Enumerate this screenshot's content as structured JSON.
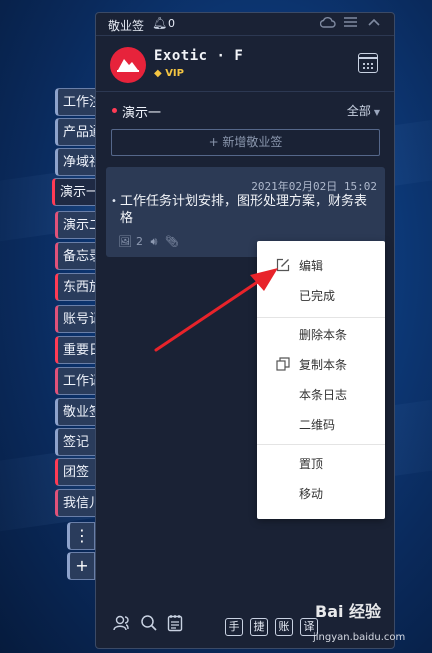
{
  "app": {
    "title": "敬业签",
    "notification_count": "0"
  },
  "user": {
    "name": "Exotic · F",
    "badge": "VIP"
  },
  "sidebar_tabs": [
    {
      "label": "工作注"
    },
    {
      "label": "产品通"
    },
    {
      "label": "净域社"
    },
    {
      "label": "演示一"
    },
    {
      "label": "演示二"
    },
    {
      "label": "备忘录"
    },
    {
      "label": "东西放"
    },
    {
      "label": "账号记"
    },
    {
      "label": "重要日"
    },
    {
      "label": "工作记"
    },
    {
      "label": "敬业签"
    },
    {
      "label": "签记"
    },
    {
      "label": "团签"
    },
    {
      "label": "我信儿"
    }
  ],
  "sidebar_more": "⋮",
  "sidebar_add": "+",
  "group": {
    "name": "演示一",
    "filter": "全部"
  },
  "add_note": "+ 新增敬业签",
  "note": {
    "date": "2021年02月02日  15:02",
    "text": "工作任务计划安排，图形处理方案，财务表格",
    "image_count": "2"
  },
  "context_menu": {
    "items": [
      {
        "label": "编辑",
        "icon": "edit-icon"
      },
      {
        "label": "已完成",
        "icon": ""
      },
      {
        "label": "删除本条",
        "icon": ""
      },
      {
        "label": "复制本条",
        "icon": "copy-icon"
      },
      {
        "label": "本条日志",
        "icon": ""
      },
      {
        "label": "二维码",
        "icon": ""
      },
      {
        "label": "置顶",
        "icon": ""
      },
      {
        "label": "移动",
        "icon": ""
      }
    ]
  },
  "bottom_tools": [
    "手",
    "捷",
    "账",
    "译"
  ],
  "watermark": {
    "brand": "Bai 经验",
    "url": "jingyan.baidu.com"
  },
  "colors": {
    "accent_red": "#ff3b55",
    "panel_bg": "#1a2235",
    "card_bg": "#2c3a55",
    "arrow": "#e8232a"
  }
}
